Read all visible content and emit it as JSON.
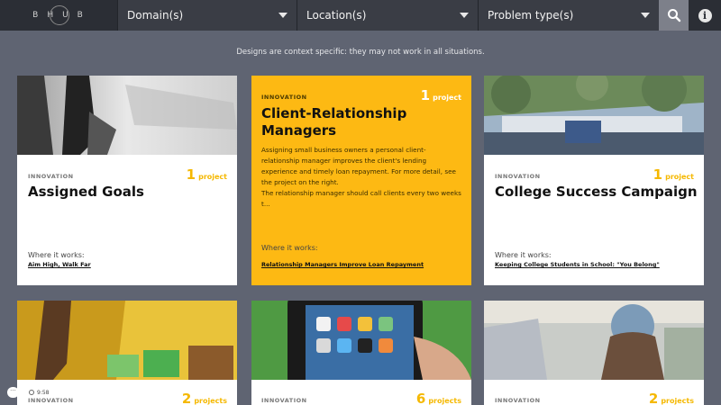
{
  "header": {
    "logo_text": "BHUB",
    "filters": [
      {
        "label": "Domain(s)"
      },
      {
        "label": "Location(s)"
      },
      {
        "label": "Problem type(s)"
      }
    ]
  },
  "disclaimer": "Designs are context specific: they may not work in all situations.",
  "cards": [
    {
      "category": "INNOVATION",
      "count": "1",
      "count_word": "project",
      "title": "Assigned Goals",
      "where_label": "Where it works:",
      "link": "Aim High, Walk Far"
    },
    {
      "category": "INNOVATION",
      "count": "1",
      "count_word": "project",
      "title": "Client-Relationship Managers",
      "description_1": "Assigning small business owners a personal client-relationship manager improves the client's lending experience and timely loan repayment. For more detail, see the project on the right.",
      "description_2": "The relationship manager should call clients every two weeks t...",
      "where_label": "Where it works:",
      "link": "Relationship Managers Improve Loan Repayment"
    },
    {
      "category": "INNOVATION",
      "count": "1",
      "count_word": "project",
      "title": "College Success Campaign",
      "where_label": "Where it works:",
      "link": "Keeping College Students in School: \"You Belong\""
    },
    {
      "category": "INNOVATION",
      "count": "2",
      "count_word": "projects"
    },
    {
      "category": "INNOVATION",
      "count": "6",
      "count_word": "projects"
    },
    {
      "category": "INNOVATION",
      "count": "2",
      "count_word": "projects"
    }
  ],
  "widget": {
    "menu": "···",
    "time": "9:58"
  },
  "colors": {
    "background": "#5f6472",
    "topbar": "#2b2e35",
    "accent": "#fdb913"
  }
}
